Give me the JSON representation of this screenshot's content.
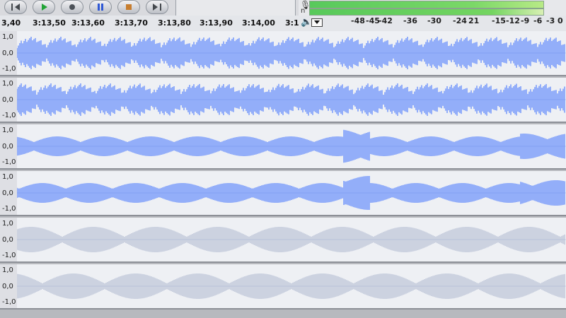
{
  "toolbar": {
    "time_ruler": [
      "3,40",
      "3:13,50",
      "3:13,60",
      "3:13,70",
      "3:13,80",
      "3:13,90",
      "3:14,00",
      "3:1"
    ],
    "meter_scale": [
      "-48",
      "-45",
      "-42",
      "-36",
      "-30",
      "-24",
      "21",
      "-15",
      "-12",
      "-9",
      "-6",
      "-3",
      "0"
    ],
    "meter_label": "n"
  },
  "tracks": [
    {
      "labels": [
        "1,0",
        "0,0",
        "-1,0"
      ],
      "color": "#2f64ff",
      "style": "blue"
    },
    {
      "labels": [
        "1,0",
        "0,0",
        "-1,0"
      ],
      "color": "#2f64ff",
      "style": "blue"
    },
    {
      "labels": [
        "1,0",
        "0,0",
        "-1,0"
      ],
      "color": "#2f64ff",
      "style": "blue"
    },
    {
      "labels": [
        "1,0",
        "0,0",
        "-1,0"
      ],
      "color": "#2f64ff",
      "style": "blue"
    },
    {
      "labels": [
        "1,0",
        "0,0",
        "-1,0"
      ],
      "color": "#8594b8",
      "style": "gray"
    },
    {
      "labels": [
        "1,0",
        "0,0",
        "-1,0"
      ],
      "color": "#8594b8",
      "style": "gray"
    }
  ]
}
